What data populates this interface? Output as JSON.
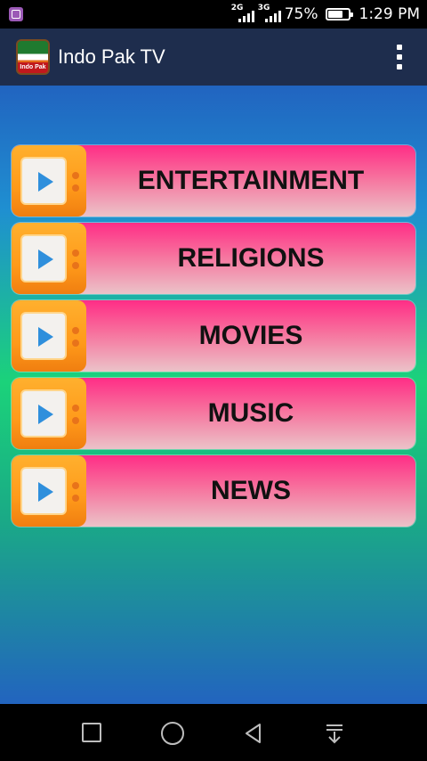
{
  "status_bar": {
    "network_1": "2G",
    "network_2": "3G",
    "battery_percent": "75%",
    "battery_level": 0.75,
    "time": "1:29 PM"
  },
  "app_bar": {
    "title": "Indo Pak TV",
    "logo_text": "Indo Pak TV"
  },
  "menu": {
    "items": [
      {
        "label": "ENTERTAINMENT",
        "icon": "tv-play-icon"
      },
      {
        "label": "RELIGIONS",
        "icon": "tv-play-icon"
      },
      {
        "label": "MOVIES",
        "icon": "tv-play-icon"
      },
      {
        "label": "MUSIC",
        "icon": "tv-play-icon"
      },
      {
        "label": "NEWS",
        "icon": "tv-play-icon"
      }
    ]
  },
  "nav_bar": {
    "buttons": [
      "recents-icon",
      "home-icon",
      "back-icon",
      "notification-pull-icon"
    ]
  },
  "colors": {
    "app_bar": "#1e2d4d",
    "menu_pink": "#ff2d86",
    "tv_orange": "#ff9a1a",
    "play_blue": "#2f8fdc"
  }
}
